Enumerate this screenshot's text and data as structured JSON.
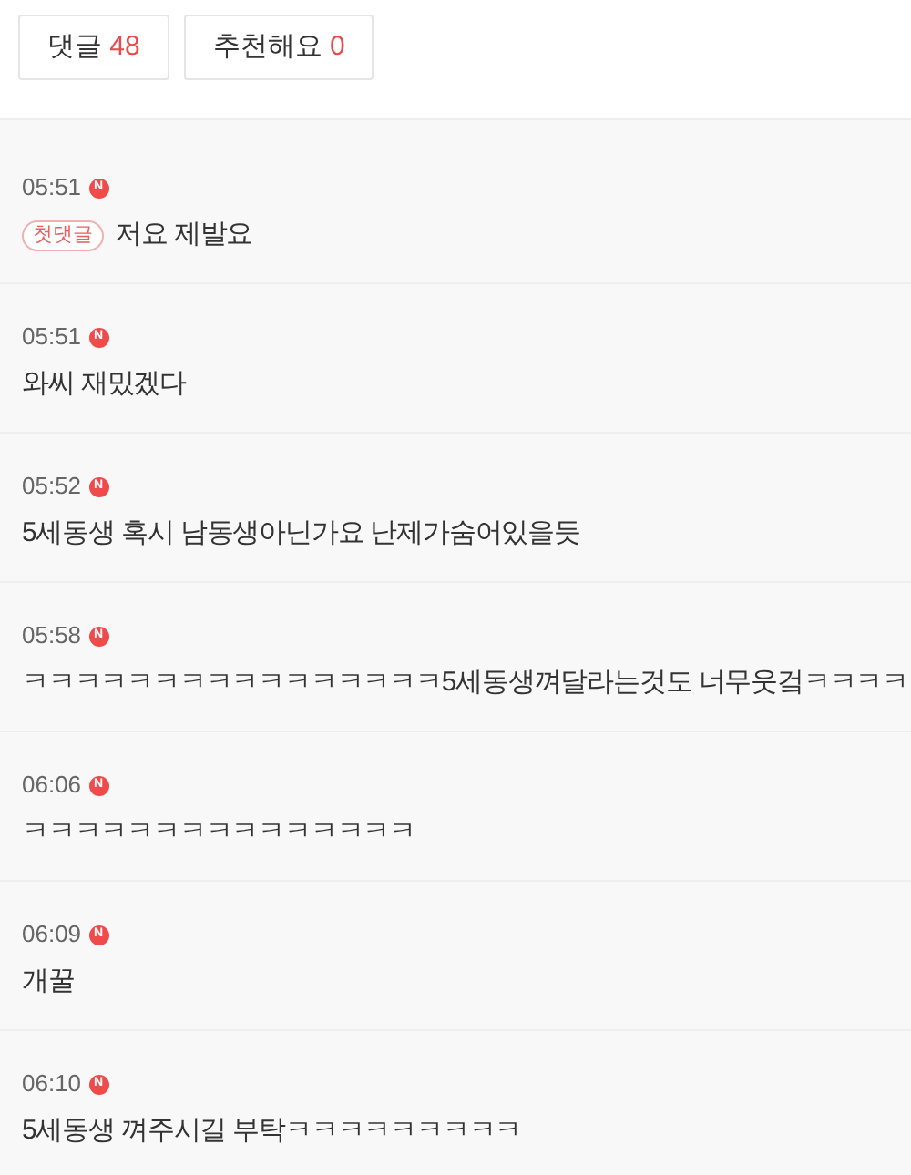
{
  "tabs": [
    {
      "label": "댓글",
      "count": "48"
    },
    {
      "label": "추천해요",
      "count": "0"
    }
  ],
  "comments": [
    {
      "time": "05:51",
      "badge": "N",
      "tag": "첫댓글",
      "text": "저요 제발요"
    },
    {
      "time": "05:51",
      "badge": "N",
      "text": "와씨 재밌겠다"
    },
    {
      "time": "05:52",
      "badge": "N",
      "text": "5세동생 혹시 남동생아닌가요 난제가숨어있을듯"
    },
    {
      "time": "05:58",
      "badge": "N",
      "text": "ㅋㅋㅋㅋㅋㅋㅋㅋㅋㅋㅋㅋㅋㅋㅋㅋ5세동생껴달라는것도 너무웃겈ㅋㅋㅋㅋ"
    },
    {
      "time": "06:06",
      "badge": "N",
      "text": "ㅋㅋㅋㅋㅋㅋㅋㅋㅋㅋㅋㅋㅋㅋㅋ"
    },
    {
      "time": "06:09",
      "badge": "N",
      "text": "개꿀"
    },
    {
      "time": "06:10",
      "badge": "N",
      "text": "5세동생 껴주시길 부탁ㅋㅋㅋㅋㅋㅋㅋㅋㅋ"
    }
  ]
}
